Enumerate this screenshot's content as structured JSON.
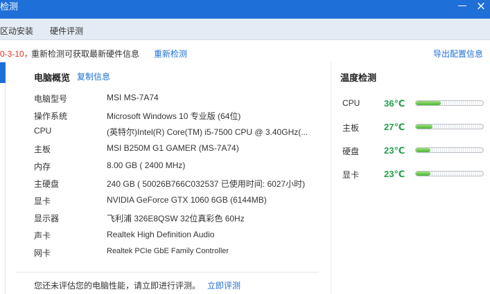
{
  "window": {
    "title": "检测",
    "close_glyph": "×"
  },
  "tabs": [
    {
      "label": "区动安装"
    },
    {
      "label": "硬件评测"
    }
  ],
  "info": {
    "date": "0-3-10，",
    "notice": "重新检测可获取最新硬件信息",
    "redetect_label": "重新检测",
    "export_label": "导出配置信息"
  },
  "overview": {
    "title": "电脑概览",
    "copy_label": "复制信息",
    "specs": [
      {
        "key": "电脑型号",
        "value": "MSI MS-7A74"
      },
      {
        "key": "操作系统",
        "value": "Microsoft Windows 10 专业版 (64位)"
      },
      {
        "key": "CPU",
        "value": "(英特尔)Intel(R) Core(TM) i5-7500 CPU @ 3.40GHz(..."
      },
      {
        "key": "主板",
        "value": "MSI B250M G1 GAMER (MS-7A74)"
      },
      {
        "key": "内存",
        "value": "8.00 GB (   2400 MHz)"
      },
      {
        "key": "主硬盘",
        "value": "240 GB (  50026B766C032537 已使用时间: 6027小时)"
      },
      {
        "key": "显卡",
        "value": "NVIDIA GeForce GTX 1060 6GB (6144MB)"
      },
      {
        "key": "显示器",
        "value": "飞利浦 326E8QSW 32位真彩色 60Hz"
      },
      {
        "key": "声卡",
        "value": "Realtek High Definition Audio"
      },
      {
        "key": "网卡",
        "value": "Realtek PCIe GbE Family Controller"
      }
    ],
    "bottom_message": "您还未评估您的电脑性能，请立即进行评测。",
    "evaluate_label": "立即评测"
  },
  "temperature": {
    "title": "温度检测",
    "items": [
      {
        "name": "CPU",
        "value": "36℃",
        "level": 0.37
      },
      {
        "name": "主板",
        "value": "27℃",
        "level": 0.25
      },
      {
        "name": "硬盘",
        "value": "23℃",
        "level": 0.22
      },
      {
        "name": "显卡",
        "value": "23℃",
        "level": 0.22
      }
    ]
  },
  "colors": {
    "titlebar": "#1f6fd8",
    "link": "#1d6fd6",
    "date_red": "#e0302a",
    "temp_green": "#22a04b"
  }
}
